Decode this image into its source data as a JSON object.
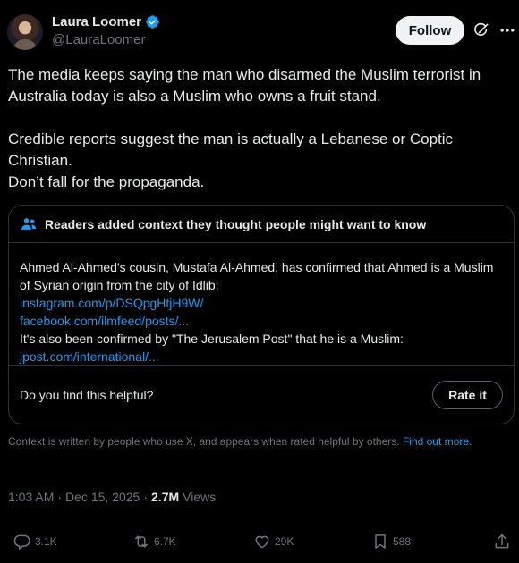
{
  "author": {
    "display_name": "Laura Loomer",
    "handle": "@LauraLoomer",
    "verified": true
  },
  "header": {
    "follow_label": "Follow",
    "icons": [
      "grok-icon",
      "more-icon",
      "verified-badge-icon"
    ]
  },
  "tweet": {
    "paragraphs": [
      "The media keeps saying the man who disarmed the Muslim terrorist in Australia today is also a Muslim who owns a fruit stand.",
      "Credible reports suggest the man is actually a Lebanese or Coptic Christian.",
      "Don’t fall for the propaganda."
    ]
  },
  "community_note": {
    "title": "Readers added context they thought people might want to know",
    "body_1": "Ahmed Al-Ahmed's cousin, Mustafa Al-Ahmed, has confirmed that Ahmed is a Muslim of Syrian origin from the city of Idlib:",
    "link_1": "instagram.com/p/DSQpgHtjH9W/",
    "link_2": "facebook.com/ilmfeed/posts/...",
    "body_2": "It's also been confirmed by \"The Jerusalem Post\" that he is a Muslim:",
    "link_3": "jpost.com/international/...",
    "helpful_prompt": "Do you find this helpful?",
    "rate_label": "Rate it"
  },
  "context_footer": {
    "text": "Context is written by people who use X, and appears when rated helpful by others.",
    "link": "Find out more."
  },
  "meta": {
    "time": "1:03 AM",
    "separator": "·",
    "date": "Dec 15, 2025",
    "separator2": "·",
    "views_count": "2.7M",
    "views_label": "Views"
  },
  "actions": {
    "replies": "3.1K",
    "reposts": "6.7K",
    "likes": "29K",
    "bookmarks": "588"
  },
  "colors": {
    "background": "#000000",
    "text": "#e7e9ea",
    "muted": "#71767b",
    "link": "#1d9bf0",
    "border": "#2f3336",
    "verified": "#1d9bf0"
  }
}
